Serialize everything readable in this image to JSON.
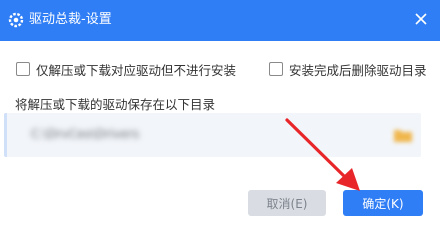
{
  "window": {
    "title": "驱动总裁-设置",
    "app_icon": "gear-icon",
    "close_icon": "close-icon"
  },
  "options": {
    "extract_only_label": "仅解压或下载对应驱动但不进行安装",
    "extract_only_checked": false,
    "delete_after_install_label": "安装完成后删除驱动目录",
    "delete_after_install_checked": false
  },
  "save_dir": {
    "label": "将解压或下载的驱动保存在以下目录",
    "path": "C:\\DrvCeo\\Drivers",
    "browse_icon": "folder-icon"
  },
  "buttons": {
    "cancel_label": "取消(E)",
    "ok_label": "确定(K)"
  },
  "colors": {
    "accent": "#2f7ef5",
    "annotation_arrow": "#e8262a",
    "disabled_button": "#d9dde3"
  }
}
